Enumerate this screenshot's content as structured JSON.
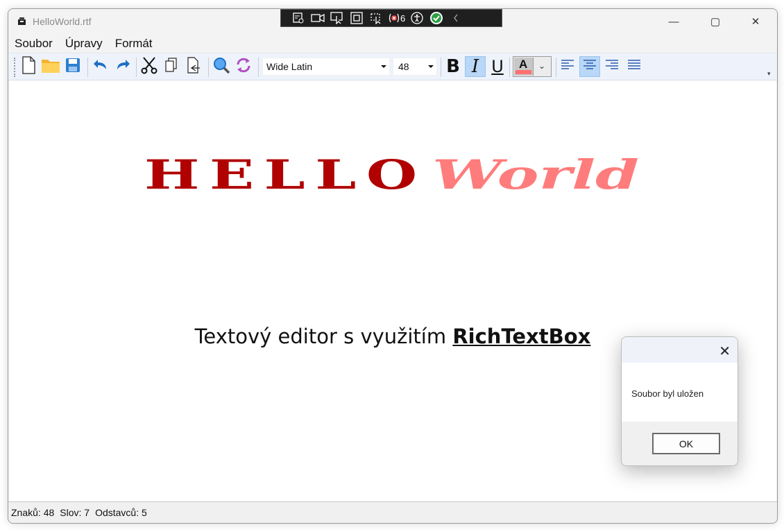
{
  "window": {
    "title": "HelloWorld.rtf",
    "minimize_glyph": "—",
    "maximize_glyph": "▢",
    "close_glyph": "✕"
  },
  "debug_toolbar": {
    "error_count": "6",
    "icons": [
      "live-visual-tree-icon",
      "camera-icon",
      "select-element-icon",
      "display-layout-icon",
      "track-focus-icon",
      "binding-failures-icon",
      "accessibility-icon",
      "check-icon",
      "collapse-chevron-icon"
    ]
  },
  "menu": {
    "items": [
      "Soubor",
      "Úpravy",
      "Formát"
    ]
  },
  "toolbar": {
    "font_name": "Wide Latin",
    "font_size": "48",
    "bold_label": "B",
    "italic_label": "I",
    "underline_label": "U",
    "color_label": "A",
    "italic_pressed": true,
    "align_center_pressed": true,
    "font_color": "#ff6f6f"
  },
  "document": {
    "hello": "HELLO",
    "world": "World",
    "line_prefix": "Textový editor s využitím ",
    "line_bold": "RichTextBox",
    "hello_color": "#b00000",
    "world_color": "#ff7c7c"
  },
  "status": {
    "chars": "Znaků: 48",
    "words": "Slov: 7",
    "paragraphs": "Odstavců: 5"
  },
  "dialog": {
    "message": "Soubor byl uložen",
    "ok_label": "OK",
    "close_glyph": "✕"
  }
}
